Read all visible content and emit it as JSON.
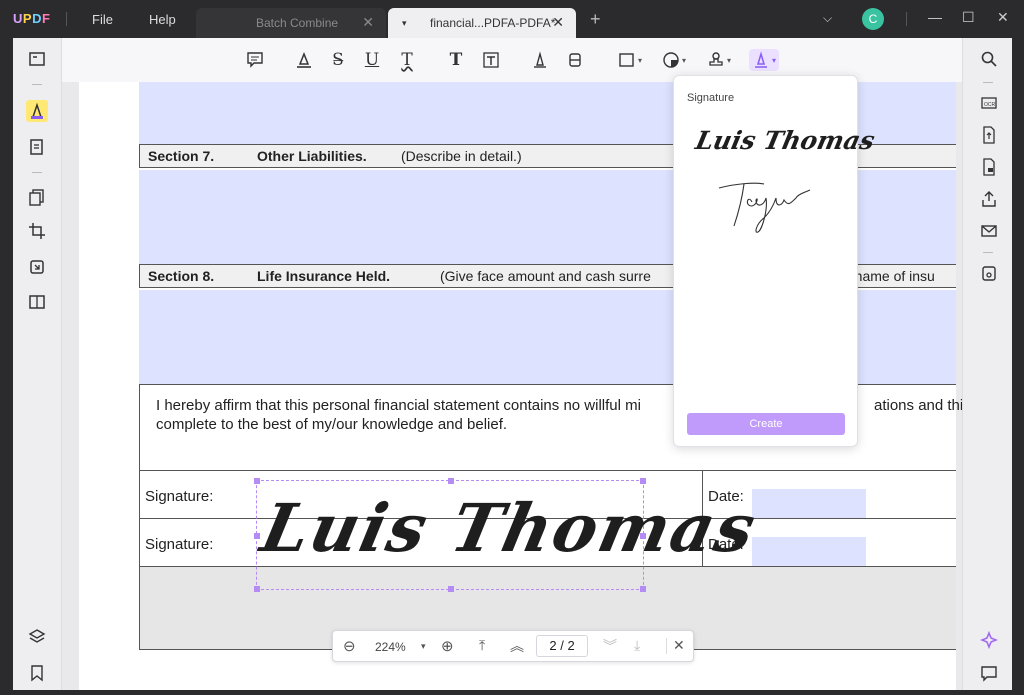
{
  "app": {
    "logo": "UPDF",
    "menu": [
      "File",
      "Help"
    ],
    "tabs": [
      {
        "label": "Batch Combine",
        "active": false
      },
      {
        "label": "financial...PDFA-PDFA*",
        "active": true
      }
    ],
    "avatar_letter": "C",
    "accent_color": "#b58cf5"
  },
  "toolbar": {
    "tools": [
      "comment-icon",
      "highlight-icon",
      "strikethrough-icon",
      "underline-icon",
      "squiggly-icon",
      "text-icon",
      "textbox-icon",
      "pencil-icon",
      "eraser-icon",
      "shape-icon",
      "sticker-icon",
      "stamp-icon",
      "signature-icon"
    ]
  },
  "document": {
    "section7": {
      "num": "Section 7.",
      "title": "Other Liabilities.",
      "desc": "(Describe in detail.)"
    },
    "section8": {
      "num": "Section 8.",
      "title": "Life Insurance Held.",
      "desc": "(Give face amount and cash surre",
      "desc_tail": "d name of insu"
    },
    "affirm_line1": "I hereby affirm that this personal financial statement contains no willful mi",
    "affirm_line1_tail": "ations and this",
    "affirm_line2": "complete to the best of my/our knowledge and belief.",
    "rows": [
      {
        "label": "Signature:",
        "date_label": "Date:"
      },
      {
        "label": "Signature:",
        "date_label": "Date:"
      }
    ],
    "placed_signature": "Luis Thomas"
  },
  "signature_popup": {
    "title": "Signature",
    "saved": [
      "Luis Thomas",
      "Taylor"
    ],
    "create_label": "Create"
  },
  "pagenav": {
    "zoom": "224%",
    "current_page": "2",
    "separator": "/",
    "total_pages": "2"
  }
}
